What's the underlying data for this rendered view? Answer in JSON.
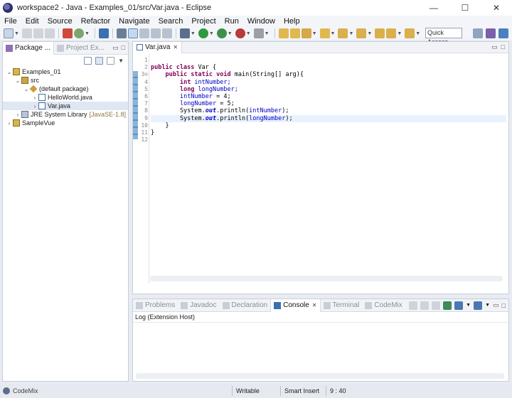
{
  "window": {
    "title": "workspace2 - Java - Examples_01/src/Var.java - Eclipse",
    "minimize": "—",
    "maximize": "☐",
    "close": "✕"
  },
  "menu": [
    "File",
    "Edit",
    "Source",
    "Refactor",
    "Navigate",
    "Search",
    "Project",
    "Run",
    "Window",
    "Help"
  ],
  "toolbar": {
    "quick_access": "Quick Access"
  },
  "left_pane": {
    "tabs": [
      "Package ...",
      "Project Ex..."
    ],
    "tree": [
      {
        "label": "Examples_01",
        "icon": "project-icon",
        "level": 0,
        "expanded": true
      },
      {
        "label": "src",
        "icon": "src-folder-icon",
        "level": 1,
        "expanded": true
      },
      {
        "label": "(default package)",
        "icon": "package-icon",
        "level": 2,
        "expanded": true
      },
      {
        "label": "HelloWorld.java",
        "icon": "java-file-icon",
        "level": 3,
        "expanded": false
      },
      {
        "label": "Var.java",
        "icon": "java-file-icon",
        "level": 3,
        "expanded": false,
        "selected": true
      },
      {
        "label": "JRE System Library",
        "suffix": "[JavaSE-1.8]",
        "icon": "library-icon",
        "level": 1,
        "expanded": false
      },
      {
        "label": "SampleVue",
        "icon": "project-icon",
        "level": 0,
        "expanded": false
      }
    ]
  },
  "editor": {
    "tab": "Var.java",
    "line_numbers": [
      "1",
      "2",
      "3⊖",
      "4",
      "5",
      "6",
      "7",
      "8",
      "9",
      "10",
      "11",
      "12"
    ],
    "current_line": 9,
    "lines": [
      [],
      [
        {
          "t": "public class",
          "c": "kw"
        },
        {
          "t": " Var {",
          "c": ""
        }
      ],
      [
        {
          "t": "    ",
          "c": ""
        },
        {
          "t": "public static void",
          "c": "kw"
        },
        {
          "t": " main(String[] arg){",
          "c": ""
        }
      ],
      [
        {
          "t": "        ",
          "c": ""
        },
        {
          "t": "int",
          "c": "kw"
        },
        {
          "t": " intNumber;",
          "c": "fld"
        }
      ],
      [
        {
          "t": "        ",
          "c": ""
        },
        {
          "t": "long",
          "c": "kw"
        },
        {
          "t": " longNumber;",
          "c": "fld"
        }
      ],
      [
        {
          "t": "        ",
          "c": ""
        },
        {
          "t": "intNumber",
          "c": "fld"
        },
        {
          "t": " = 4;",
          "c": ""
        }
      ],
      [
        {
          "t": "        ",
          "c": ""
        },
        {
          "t": "longNumber",
          "c": "fld"
        },
        {
          "t": " = 5;",
          "c": ""
        }
      ],
      [
        {
          "t": "        System.",
          "c": ""
        },
        {
          "t": "out",
          "c": "st"
        },
        {
          "t": ".println(",
          "c": ""
        },
        {
          "t": "intNumber",
          "c": "fld"
        },
        {
          "t": ");",
          "c": ""
        }
      ],
      [
        {
          "t": "        System.",
          "c": ""
        },
        {
          "t": "out",
          "c": "st"
        },
        {
          "t": ".println(",
          "c": ""
        },
        {
          "t": "longNumber",
          "c": "fld"
        },
        {
          "t": ");",
          "c": ""
        }
      ],
      [
        {
          "t": "    }",
          "c": ""
        }
      ],
      [
        {
          "t": "}",
          "c": ""
        }
      ],
      []
    ]
  },
  "console": {
    "tabs": [
      {
        "label": "Problems",
        "active": false
      },
      {
        "label": "Javadoc",
        "active": false
      },
      {
        "label": "Declaration",
        "active": false
      },
      {
        "label": "Console",
        "active": true,
        "close": "✕"
      },
      {
        "label": "Terminal",
        "active": false
      },
      {
        "label": "CodeMix",
        "active": false
      }
    ],
    "log_label": "Log (Extension Host)"
  },
  "status": {
    "left": "CodeMix",
    "writable": "Writable",
    "insert_mode": "Smart Insert",
    "position": "9 : 40"
  }
}
